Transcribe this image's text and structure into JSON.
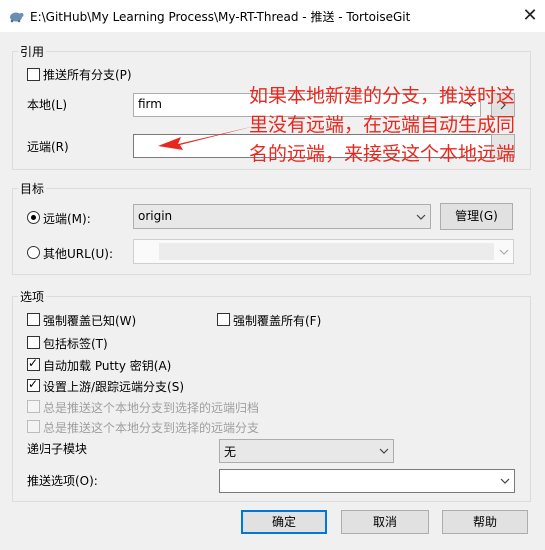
{
  "window": {
    "title": "E:\\GitHub\\My Learning Process\\My-RT-Thread - 推送 - TortoiseGit",
    "close_glyph": "✕"
  },
  "ref_group": {
    "legend": "引用",
    "push_all_branches": "推送所有分支(P)",
    "local_label": "本地(L)",
    "local_value": "firm",
    "remote_label": "远端(R)",
    "remote_value": ""
  },
  "annotation": {
    "text": "如果本地新建的分支，推送时这里没有远端，在远端自动生成同名的远端，来接受这个本地远端",
    "color": "#e8281e"
  },
  "target_group": {
    "legend": "目标",
    "remote_label": "远端(M):",
    "remote_value": "origin",
    "manage_button": "管理(G)",
    "other_url_label": "其他URL(U):",
    "other_url_value": ""
  },
  "options_group": {
    "legend": "选项",
    "force_overwrite_known": "强制覆盖已知(W)",
    "force_overwrite_all": "强制覆盖所有(F)",
    "include_tags": "包括标签(T)",
    "autoload_putty": "自动加载 Putty 密钥(A)",
    "set_upstream": "设置上游/跟踪远端分支(S)",
    "always_push_to_remote_archive": "总是推送这个本地分支到选择的远端归档",
    "always_push_to_remote_branch": "总是推送这个本地分支到选择的远端分支",
    "recurse_submodules_label": "递归子模块",
    "recurse_submodules_value": "无",
    "push_options_label": "推送选项(O):",
    "push_options_value": ""
  },
  "buttons": {
    "ok": "确定",
    "cancel": "取消",
    "help": "帮助"
  }
}
